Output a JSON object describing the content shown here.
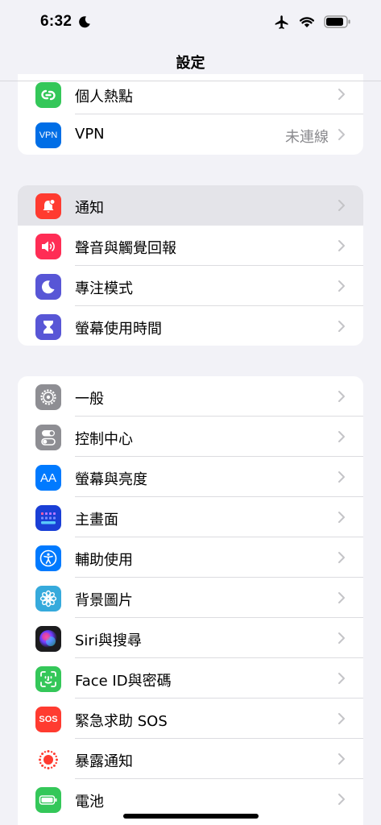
{
  "status": {
    "time": "6:32"
  },
  "nav": {
    "title": "設定"
  },
  "group1": [
    {
      "label": "個人熱點",
      "icon": "hotspot-icon",
      "color": "#34c759"
    },
    {
      "label": "VPN",
      "value": "未連線",
      "icon": "vpn-icon",
      "icon_text": "VPN",
      "color": "#006ee6"
    }
  ],
  "group2": [
    {
      "label": "通知",
      "icon": "bell-icon",
      "color": "#ff3b30"
    },
    {
      "label": "聲音與觸覺回報",
      "icon": "speaker-icon",
      "color": "#ff2d55"
    },
    {
      "label": "專注模式",
      "icon": "moon-icon",
      "color": "#5856d6"
    },
    {
      "label": "螢幕使用時間",
      "icon": "hourglass-icon",
      "color": "#5856d6"
    }
  ],
  "group3": [
    {
      "label": "一般",
      "icon": "gear-icon",
      "color": "#8e8e93"
    },
    {
      "label": "控制中心",
      "icon": "toggles-icon",
      "color": "#8e8e93"
    },
    {
      "label": "螢幕與亮度",
      "icon": "text-size-icon",
      "icon_text": "AA",
      "color": "#007aff"
    },
    {
      "label": "主畫面",
      "icon": "home-grid-icon",
      "color": "#1a3fd6"
    },
    {
      "label": "輔助使用",
      "icon": "accessibility-icon",
      "color": "#007aff"
    },
    {
      "label": "背景圖片",
      "icon": "flower-icon",
      "color": "#36aadc"
    },
    {
      "label": "Siri與搜尋",
      "icon": "siri-icon",
      "color": "#1c1c1e"
    },
    {
      "label": "Face ID與密碼",
      "icon": "face-id-icon",
      "color": "#34c759"
    },
    {
      "label": "緊急求助 SOS",
      "icon": "sos-icon",
      "icon_text": "SOS",
      "color": "#ff3b30"
    },
    {
      "label": "暴露通知",
      "icon": "exposure-icon",
      "color": "#ffffff"
    },
    {
      "label": "電池",
      "icon": "battery-icon",
      "color": "#34c759"
    }
  ]
}
